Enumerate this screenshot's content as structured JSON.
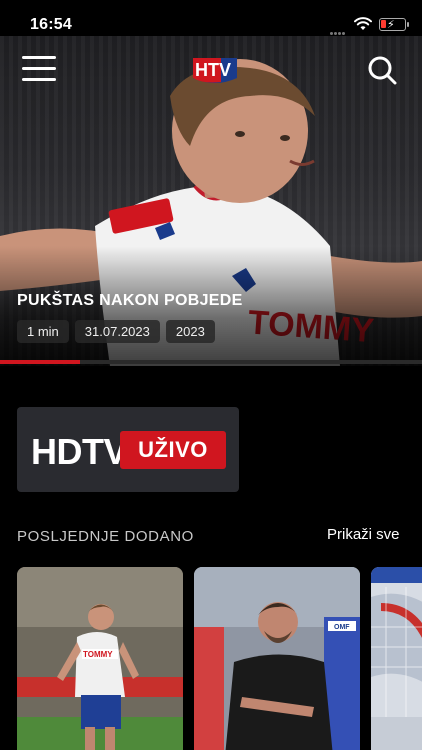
{
  "status_bar": {
    "time": "16:54"
  },
  "header": {
    "menu_icon": "hamburger-menu-icon",
    "logo": "hnk-hajduk-tv-logo",
    "search_icon": "search-icon"
  },
  "hero": {
    "title": "PUKŠTAS NAKON POBJEDE",
    "tags": [
      "1 min",
      "31.07.2023",
      "2023"
    ],
    "progress": 0.19,
    "logo_text": "HTV"
  },
  "live_banner": {
    "label": "HDTV",
    "badge": "UŽIVO"
  },
  "section": {
    "title": "POSLJEDNJE DODANO",
    "show_all": "Prikaži sve"
  },
  "thumbnails": [
    {
      "sponsor": "TOMMY"
    },
    {
      "sponsor": "OMF"
    },
    {
      "sponsor": ""
    }
  ],
  "colors": {
    "accent": "#d0161f",
    "card": "#2a2b30",
    "background": "#000000"
  }
}
